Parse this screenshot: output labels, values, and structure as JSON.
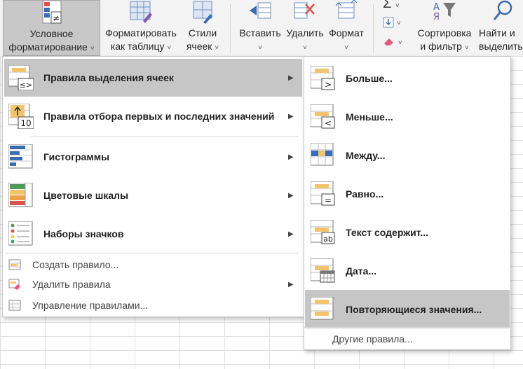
{
  "ribbon": {
    "buttons": [
      {
        "label": "Условное форматирование ˅"
      },
      {
        "label": "Форматировать как таблицу ˅"
      },
      {
        "label": "Стили ячеек ˅"
      },
      {
        "label": "Вставить ˅"
      },
      {
        "label": "Удалить ˅"
      },
      {
        "label": "Формат ˅"
      },
      {
        "label": "Σ ˅"
      },
      {
        "label": "Сортировка и фильтр ˅"
      },
      {
        "label": "Найти и выделить"
      }
    ],
    "cond_line1": "Условное",
    "cond_line2": "форматирование",
    "fmt_table_line1": "Форматировать",
    "fmt_table_line2": "как таблицу",
    "styles_line1": "Стили",
    "styles_line2": "ячеек",
    "insert": "Вставить",
    "delete": "Удалить",
    "format": "Формат",
    "sort_line1": "Сортировка",
    "sort_line2": "и фильтр",
    "find_line1": "Найти и",
    "find_line2": "выделить"
  },
  "menu": {
    "items": [
      {
        "label": "Правила выделения ячеек"
      },
      {
        "label": "Правила отбора первых и последних значений"
      },
      {
        "label": "Гистограммы"
      },
      {
        "label": "Цветовые шкалы"
      },
      {
        "label": "Наборы значков"
      }
    ],
    "small_items": [
      {
        "label": "Создать правило..."
      },
      {
        "label": "Удалить правила"
      },
      {
        "label": "Управление правилами..."
      }
    ]
  },
  "submenu": {
    "items": [
      {
        "label": "Больше..."
      },
      {
        "label": "Меньше..."
      },
      {
        "label": "Между..."
      },
      {
        "label": "Равно..."
      },
      {
        "label": "Текст содержит..."
      },
      {
        "label": "Дата..."
      },
      {
        "label": "Повторяющиеся значения..."
      }
    ],
    "footer": "Другие правила..."
  },
  "icons": {
    "top_ten_number": "10",
    "greater": ">",
    "less": "<",
    "equal": "=",
    "text": "ab",
    "le_ge": "≤>",
    "neq": "≠"
  },
  "colors": {
    "accent_yellow": "#f2c46d",
    "accent_blue": "#3a6cb4",
    "highlight": "#c6c6c6"
  }
}
